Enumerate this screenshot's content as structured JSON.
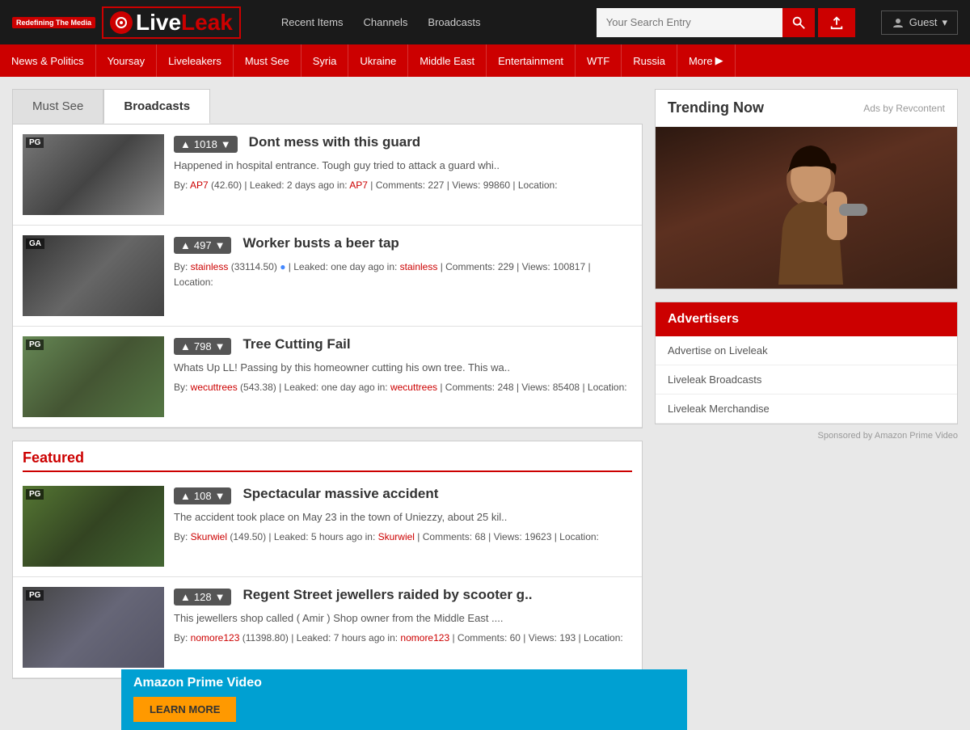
{
  "site": {
    "tagline": "Redefining The Media",
    "logo_live": "Live",
    "logo_leak": "Leak"
  },
  "header": {
    "nav": [
      {
        "label": "Recent Items",
        "href": "#"
      },
      {
        "label": "Channels",
        "href": "#"
      },
      {
        "label": "Broadcasts",
        "href": "#"
      }
    ],
    "search_placeholder": "Your Search Entry",
    "guest_label": "Guest"
  },
  "topnav": {
    "items": [
      {
        "label": "News & Politics"
      },
      {
        "label": "Yoursay"
      },
      {
        "label": "Liveleakers"
      },
      {
        "label": "Must See"
      },
      {
        "label": "Syria"
      },
      {
        "label": "Ukraine"
      },
      {
        "label": "Middle East"
      },
      {
        "label": "Entertainment"
      },
      {
        "label": "WTF"
      },
      {
        "label": "Russia"
      },
      {
        "label": "More"
      }
    ]
  },
  "tabs": [
    {
      "label": "Must See",
      "active": false
    },
    {
      "label": "Broadcasts",
      "active": true
    }
  ],
  "videos": [
    {
      "rating": "PG",
      "votes": "1018",
      "title": "Dont mess with this guard",
      "description": "Happened in hospital entrance. Tough guy tried to attack a guard whi..",
      "author": "AP7",
      "author_score": "42.60",
      "leaked": "2 days ago",
      "channel": "AP7",
      "comments": "227",
      "views": "99860",
      "location": "",
      "thumb_class": "thumb-1"
    },
    {
      "rating": "GA",
      "votes": "497",
      "title": "Worker busts a beer tap",
      "description": "",
      "author": "stainless",
      "author_score": "33114.50",
      "leaked": "one day ago",
      "channel": "stainless",
      "comments": "229",
      "views": "100817",
      "location": "",
      "thumb_class": "thumb-2"
    },
    {
      "rating": "PG",
      "votes": "798",
      "title": "Tree Cutting Fail",
      "description": "Whats Up LL! Passing by this homeowner cutting his own tree. This wa..",
      "author": "wecuttrees",
      "author_score": "543.38",
      "leaked": "one day ago",
      "channel": "wecuttrees",
      "comments": "248",
      "views": "85408",
      "location": "",
      "thumb_class": "thumb-3"
    }
  ],
  "featured": {
    "title": "Featured",
    "items": [
      {
        "rating": "PG",
        "votes": "108",
        "title": "Spectacular massive accident",
        "description": "The accident took place on May 23 in the town of Uniezzy, about 25 kil..",
        "author": "Skurwiel",
        "author_score": "149.50",
        "leaked": "5 hours ago",
        "channel": "Skurwiel",
        "comments": "68",
        "views": "19623",
        "location": "",
        "thumb_class": "thumb-4"
      },
      {
        "rating": "PG",
        "votes": "128",
        "title": "Regent Street jewellers raided by scooter g..",
        "description": "This jewellers shop called ( Amir ) Shop owner from the Middle East ....",
        "author": "nomore123",
        "author_score": "11398.80",
        "leaked": "7 hours ago",
        "channel": "nomore123",
        "comments": "60",
        "views": "193",
        "location": "",
        "thumb_class": "thumb-5"
      }
    ]
  },
  "sidebar": {
    "trending_title": "Trending Now",
    "trending_ads": "Ads by Revcontent",
    "advertisers_title": "Advertisers",
    "advertiser_links": [
      {
        "label": "Advertise on Liveleak"
      },
      {
        "label": "Liveleak Broadcasts"
      },
      {
        "label": "Liveleak Merchandise"
      }
    ]
  },
  "amazon": {
    "title": "Amazon Prime Video",
    "button_label": "LEARN MORE",
    "sponsored": "Sponsored by Amazon Prime Video"
  }
}
